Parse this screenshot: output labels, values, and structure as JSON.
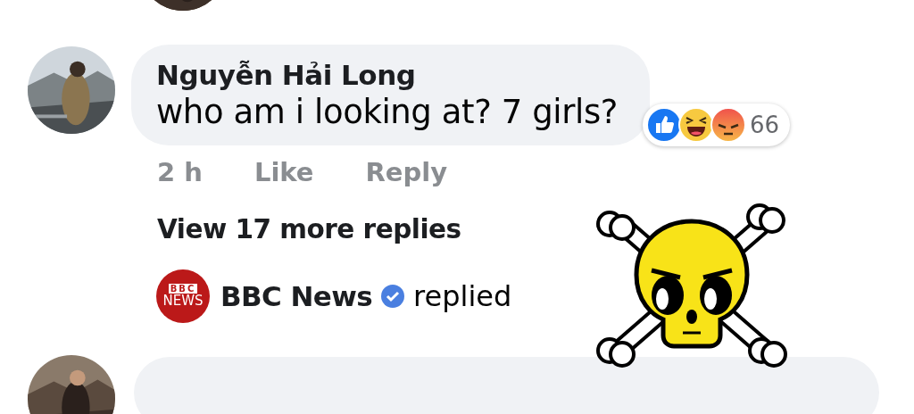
{
  "comment": {
    "author": "Nguyễn Hải Long",
    "text": "who am i looking at? 7 girls?",
    "reactions": {
      "types": [
        {
          "kind": "like"
        },
        {
          "kind": "haha"
        },
        {
          "kind": "angry"
        }
      ],
      "count": "66"
    },
    "time": "2 h",
    "actions": [
      "Like",
      "Reply"
    ]
  },
  "view_more": "View 17 more replies",
  "reply_preview": {
    "logo_top": "BBC",
    "logo_bottom": "NEWS",
    "name": "BBC News",
    "verified": true,
    "action": "replied"
  },
  "sticker": {
    "kind": "skull-face"
  }
}
